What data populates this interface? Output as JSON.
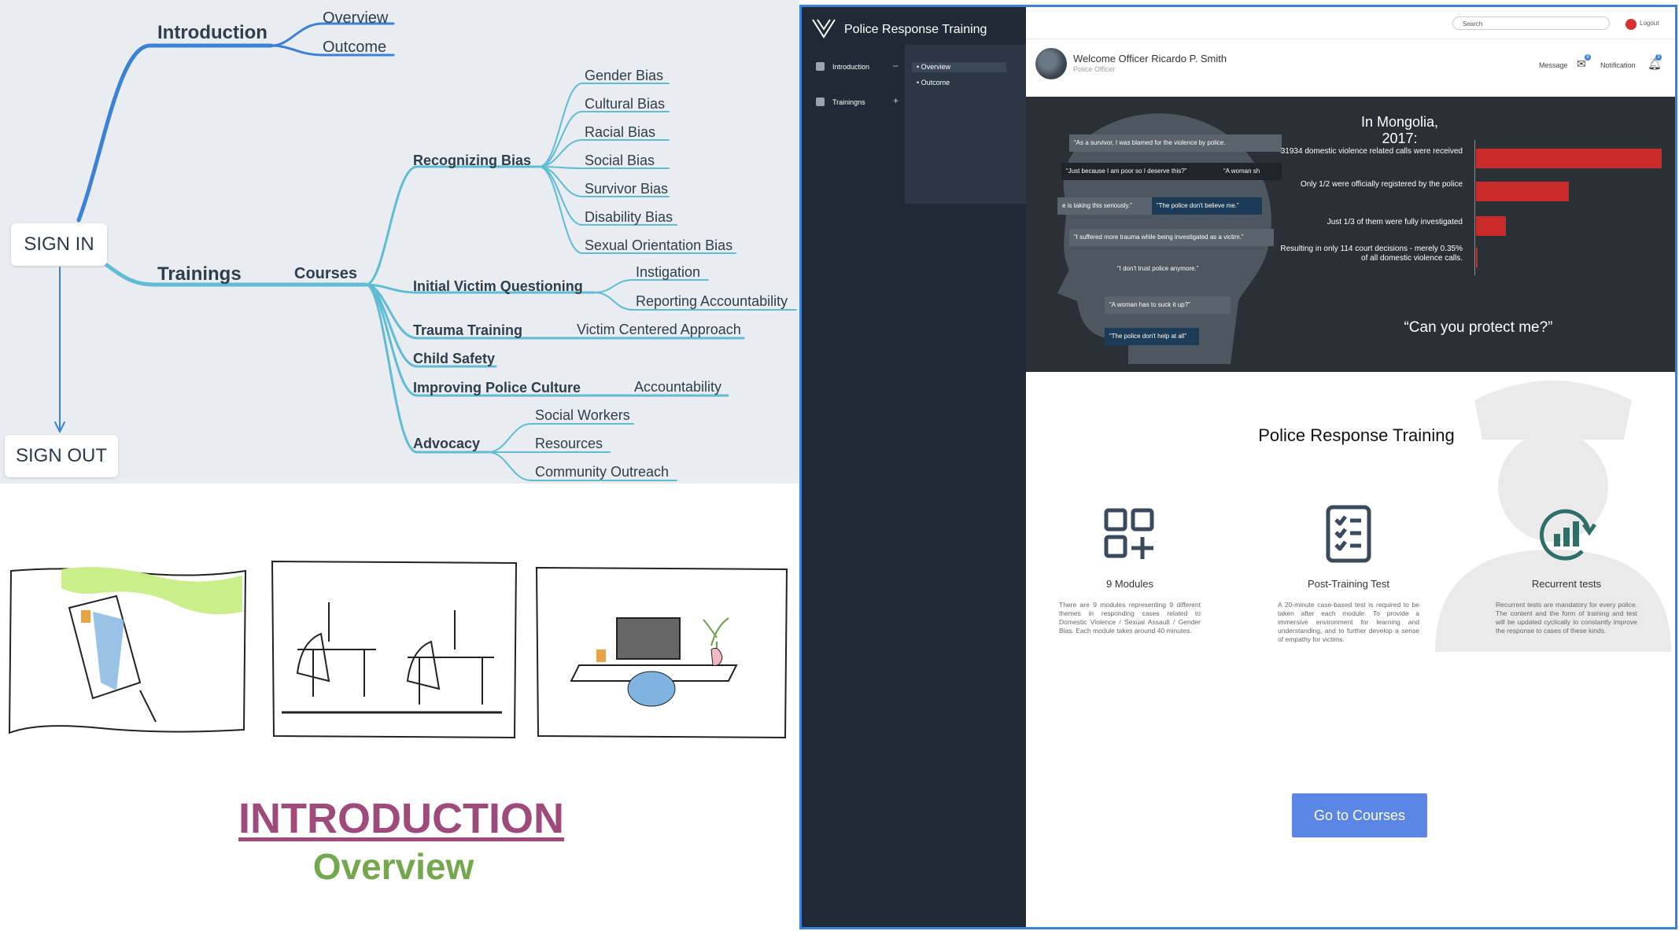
{
  "mindmap": {
    "root_signin": "SIGN IN",
    "root_signout": "SIGN OUT",
    "introduction": "Introduction",
    "intro_children": [
      "Overview",
      "Outcome"
    ],
    "trainings": "Trainings",
    "courses": "Courses",
    "recognizing_bias": "Recognizing Bias",
    "bias_items": [
      "Gender Bias",
      "Cultural Bias",
      "Racial Bias",
      "Social Bias",
      "Survivor Bias",
      "Disability Bias",
      "Sexual Orientation Bias"
    ],
    "initial_victim_questioning": "Initial Victim Questioning",
    "ivq_items": [
      "Instigation",
      "Reporting Accountability"
    ],
    "trauma_training": "Trauma Training",
    "trauma_item": "Victim Centered Approach",
    "child_safety": "Child Safety",
    "improving_police_culture": "Improving Police Culture",
    "ipc_item": "Accountability",
    "advocacy": "Advocacy",
    "advocacy_items": [
      "Social Workers",
      "Resources",
      "Community Outreach"
    ]
  },
  "intro_caption": {
    "title": "INTRODUCTION",
    "subtitle": "Overview"
  },
  "app": {
    "title": "Police Response  Training",
    "search_placeholder": "Search",
    "logout": "Logout",
    "sidebar": {
      "items": [
        {
          "label": "Introduction",
          "sign": "–"
        },
        {
          "label": "Trainingns",
          "sign": "+"
        }
      ],
      "subitems": [
        "• Overview",
        "• Outcome"
      ]
    },
    "header": {
      "welcome": "Welcome Officer Ricardo P. Smith",
      "role": "Police Officer",
      "message": "Message",
      "message_badge": "8",
      "notification": "Notification",
      "notification_badge": "3"
    },
    "hero": {
      "quotes": [
        "“As a survivor, I was blamed for the violence by police.",
        "“Just because I am poor so I deserve this?”",
        "“A woman sh",
        "e is taking this seriously.”",
        "“The police don't believe me.”",
        "“I suffered more trauma while being investigated as a victim.”",
        "“I don't trust police anymore.”",
        "“A woman has to suck it up?”",
        "“The police don't help at all”"
      ],
      "stats_title": "In Mongolia, 2017:",
      "stats": [
        {
          "label": "31934 domestic violence related calls were received",
          "value": 100
        },
        {
          "label": "Only 1/2 were officially registered by the police",
          "value": 50
        },
        {
          "label": "Just 1/3 of them were fully investigated",
          "value": 16
        },
        {
          "label": "Resulting in only 114 court decisions - merely 0.35% of all domestic violence calls.",
          "value": 0.35
        }
      ],
      "question": "“Can you protect me?”"
    },
    "section_title": "Police Response Training",
    "features": [
      {
        "icon": "modules-icon",
        "label": "9 Modules",
        "desc": "There are 9 modules representing 9 different themes in responding cases related to Domestic Violence / Sexual Assault / Gender Bias. Each module takes around 40 minutes."
      },
      {
        "icon": "checklist-icon",
        "label": "Post-Training Test",
        "desc": "A 20-minute case-based test is required to be taken after each module. To provide a immersive environment for learning and understanding, and to further develop a sense of empathy for victims."
      },
      {
        "icon": "recurrent-chart-icon",
        "label": "Recurrent tests",
        "desc": "Recurrent tests are mandatory for every police. The content and the form of training and test will be updated cyclically to constantly improve the response to cases of these kinds."
      }
    ],
    "cta_button": "Go to Courses"
  },
  "colors": {
    "mindmap_line_blue": "#3b82d6",
    "mindmap_line_teal": "#5fbcd3",
    "hero_bar": "#c92a2a",
    "intro_title": "#9e4a7a",
    "intro_subtitle": "#74a84e",
    "button": "#5b86e5",
    "sidebar": "#1f2a36"
  }
}
